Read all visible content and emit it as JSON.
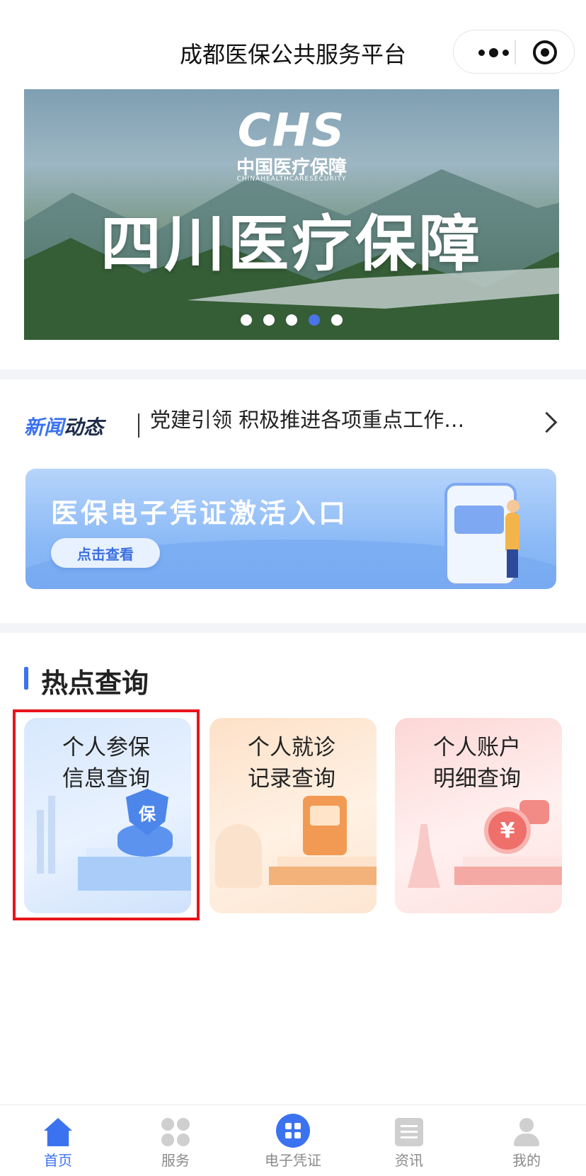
{
  "header": {
    "title": "成都医保公共服务平台"
  },
  "banner": {
    "logo_mark": "CHS",
    "logo_cn": "中国医疗保障",
    "logo_en": "CHINAHEALTHCARESECURITY",
    "headline": "四川医疗保障",
    "slide_count": 5,
    "active_slide": 4
  },
  "news": {
    "tag_part1": "新闻",
    "tag_part2": "动态",
    "headline": "党建引领 积极推进各项重点工作…"
  },
  "promo": {
    "title": "医保电子凭证激活入口",
    "button_label": "点击查看"
  },
  "hot_query": {
    "title": "热点查询",
    "cards": [
      {
        "line1": "个人参保",
        "line2": "信息查询",
        "icon_text": "保"
      },
      {
        "line1": "个人就诊",
        "line2": "记录查询"
      },
      {
        "line1": "个人账户",
        "line2": "明细查询",
        "icon_text": "¥"
      }
    ]
  },
  "tabbar": {
    "items": [
      {
        "label": "首页",
        "icon": "home-icon",
        "active": true
      },
      {
        "label": "服务",
        "icon": "service-grid-icon"
      },
      {
        "label": "电子凭证",
        "icon": "qr-code-icon"
      },
      {
        "label": "资讯",
        "icon": "news-icon"
      },
      {
        "label": "我的",
        "icon": "user-icon"
      }
    ]
  },
  "colors": {
    "accent": "#3b72f0",
    "highlight_box": "#e8141a",
    "tab_inactive": "#8a8a8a"
  }
}
